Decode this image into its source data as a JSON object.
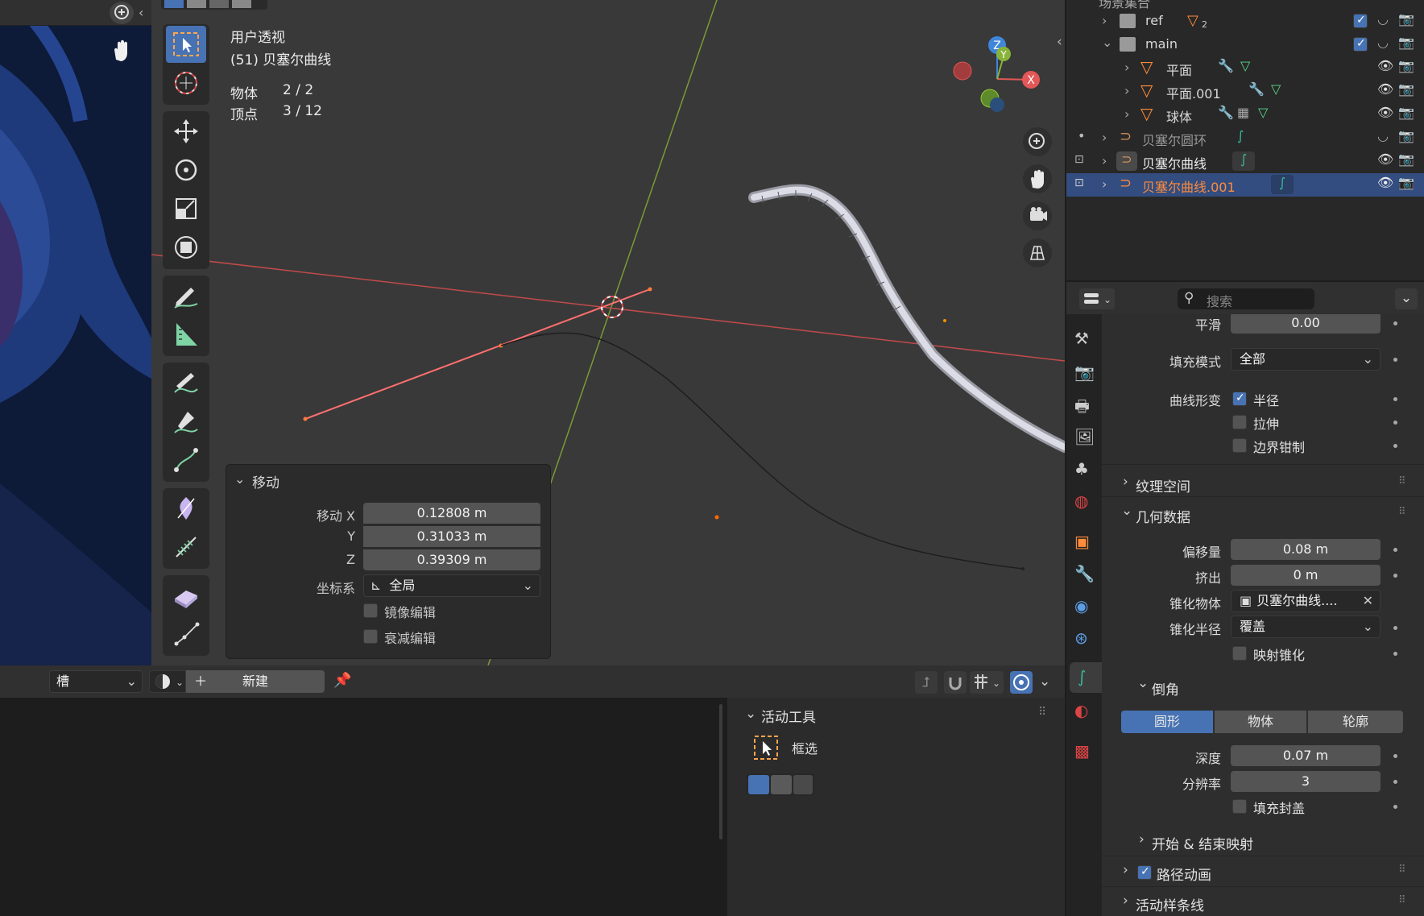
{
  "viewport": {
    "view_name": "用户透视",
    "active_object": "(51) 贝塞尔曲线",
    "stats": [
      {
        "label": "物体",
        "value": "2 / 2"
      },
      {
        "label": "顶点",
        "value": "3 / 12"
      }
    ],
    "gizmo_axes": {
      "x": "X",
      "y": "Y",
      "z": "Z"
    }
  },
  "operator_panel": {
    "title": "移动",
    "move_x_label": "移动 X",
    "move_x": "0.12808 m",
    "y_label": "Y",
    "move_y": "0.31033 m",
    "z_label": "Z",
    "move_z": "0.39309 m",
    "orientation_label": "坐标系",
    "orientation_value": "全局",
    "mirror_label": "镜像编辑",
    "falloff_label": "衰减编辑"
  },
  "bottom_header": {
    "slot_label": "槽",
    "new_label": "新建"
  },
  "active_tool_panel": {
    "title": "活动工具",
    "tool_name": "框选"
  },
  "outliner": {
    "top_clip": "场景集合",
    "rows": [
      {
        "name": "ref",
        "badge": "2"
      },
      {
        "name": "main"
      },
      {
        "name": "平面"
      },
      {
        "name": "平面.001"
      },
      {
        "name": "球体"
      },
      {
        "name": "贝塞尔圆环"
      },
      {
        "name": "贝塞尔曲线"
      },
      {
        "name": "贝塞尔曲线.001"
      }
    ]
  },
  "properties": {
    "search_placeholder": "搜索",
    "smooth_label": "平滑",
    "smooth_value": "0.00",
    "fill_mode_label": "填充模式",
    "fill_mode_value": "全部",
    "curve_deform_label": "曲线形变",
    "radius_label": "半径",
    "stretch_label": "拉伸",
    "bounds_clamp_label": "边界钳制",
    "texture_space_label": "纹理空间",
    "geometry_label": "几何数据",
    "offset_label": "偏移量",
    "offset_value": "0.08 m",
    "extrude_label": "挤出",
    "extrude_value": "0 m",
    "taper_object_label": "锥化物体",
    "taper_object_value": "贝塞尔曲线....",
    "taper_radius_label": "锥化半径",
    "taper_radius_value": "覆盖",
    "map_taper_label": "映射锥化",
    "bevel_label": "倒角",
    "bevel_modes": [
      "圆形",
      "物体",
      "轮廓"
    ],
    "depth_label": "深度",
    "depth_value": "0.07 m",
    "resolution_label": "分辨率",
    "resolution_value": "3",
    "fill_caps_label": "填充封盖",
    "start_end_label": "开始 & 结束映射",
    "path_anim_label": "路径动画",
    "active_spline_label": "活动样条线"
  },
  "colors": {
    "accent": "#4772b3",
    "selected_orange": "#ff8c3a",
    "x_axis": "#e25757",
    "y_axis": "#88b33a",
    "z_axis": "#3f86d9"
  }
}
